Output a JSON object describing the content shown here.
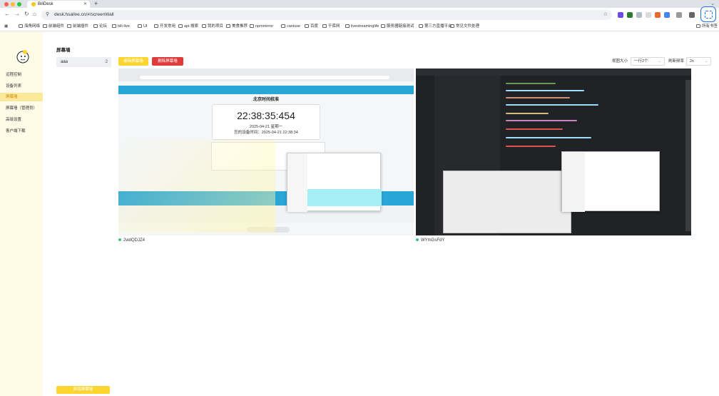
{
  "browser": {
    "tab_title": "BiliDesk",
    "url": "desk.hsalive.cn/#/screenWall",
    "bookmarks": [
      "海角网络",
      "前端组件",
      "前端插件",
      "论坛",
      "bili-live",
      "UI",
      "开发常用",
      "api-搜索",
      "我的项目",
      "美食推荐",
      "npmmirror",
      "caniuse",
      "百度",
      "千库网",
      "livestreaminglife",
      "服务器链接测试",
      "第三方直播平台",
      "常见文件处理"
    ],
    "bookmarks_right": "所有书签"
  },
  "sidebar": {
    "items": [
      {
        "label": "远程控制",
        "active": false
      },
      {
        "label": "设备列表",
        "active": false
      },
      {
        "label": "屏幕墙",
        "active": true
      },
      {
        "label": "屏幕墙（管理员）",
        "active": false
      },
      {
        "label": "高级设置",
        "active": false
      },
      {
        "label": "客户端下载",
        "active": false
      }
    ]
  },
  "page": {
    "title": "屏幕墙",
    "group": {
      "name": "aaa",
      "count": "2"
    },
    "add_group_button": "新增屏幕墙",
    "edit_button": "编辑屏幕墙",
    "delete_button": "删除屏幕墙",
    "view_size_label": "视图大小",
    "view_size_value": "一行2个",
    "refresh_label": "刷新频率",
    "refresh_value": "2s"
  },
  "tiles": [
    {
      "device_id": "2wdQDJZ4",
      "status_color": "#3cc37a",
      "preview": {
        "heading": "北京时间校准",
        "time": "22:38:35:454",
        "date": "2025-04-21 星期一",
        "device_time": "您的设备时间：2025-04-21 22:38:34"
      }
    },
    {
      "device_id": "WYmGsFdY",
      "status_color": "#3cc37a"
    }
  ],
  "colors": {
    "accent_yellow": "#fdd531",
    "danger_red": "#e03b3b",
    "active_menu_bg": "#fde79a",
    "sidebar_bg": "#fffbe6"
  }
}
